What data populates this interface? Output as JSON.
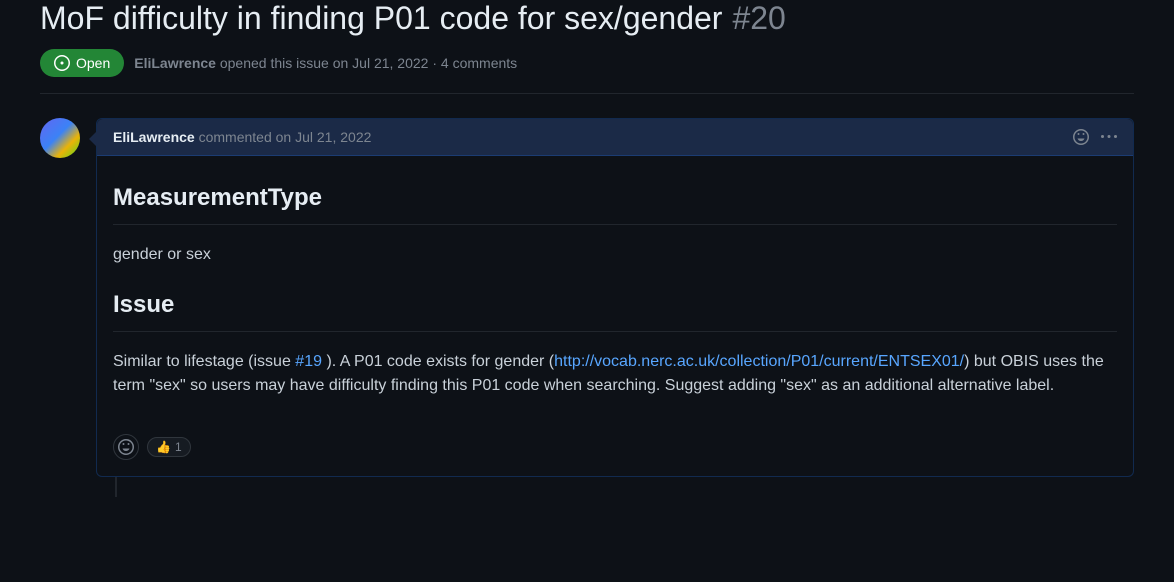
{
  "issue": {
    "title": "MoF difficulty in finding P01 code for sex/gender",
    "number": "#20",
    "state": "Open",
    "author": "EliLawrence",
    "opened_verb": "opened this issue",
    "opened_date": "on Jul 21, 2022",
    "comment_count_text": "4 comments"
  },
  "comment": {
    "author": "EliLawrence",
    "verb": "commented",
    "date": "on Jul 21, 2022",
    "heading1": "MeasurementType",
    "body1": "gender or sex",
    "heading2": "Issue",
    "body2_pre": "Similar to lifestage (issue ",
    "body2_link1_text": "#19",
    "body2_mid1": " ). A P01 code exists for gender (",
    "body2_link2_text": "http://vocab.nerc.ac.uk/collection/P01/current/ENTSEX01/",
    "body2_post": ") but OBIS uses the term \"sex\" so users may have difficulty finding this P01 code when searching. Suggest adding \"sex\" as an additional alternative label.",
    "reaction_emoji": "👍",
    "reaction_count": "1"
  }
}
